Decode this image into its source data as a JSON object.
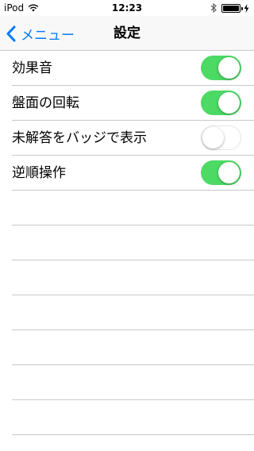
{
  "status_bar": {
    "carrier": "iPod",
    "time": "12:23",
    "icons": [
      "wifi-icon",
      "bluetooth-icon",
      "battery-icon",
      "charging-icon"
    ],
    "battery_level": 1.0
  },
  "nav": {
    "back_label": "メニュー",
    "title": "設定",
    "accent_color": "#007aff"
  },
  "settings": [
    {
      "label": "効果音",
      "on": true
    },
    {
      "label": "盤面の回転",
      "on": true
    },
    {
      "label": "未解答をバッジで表示",
      "on": false
    },
    {
      "label": "逆順操作",
      "on": true
    }
  ],
  "colors": {
    "switch_on": "#4cd964",
    "separator": "#c8c7cc"
  }
}
